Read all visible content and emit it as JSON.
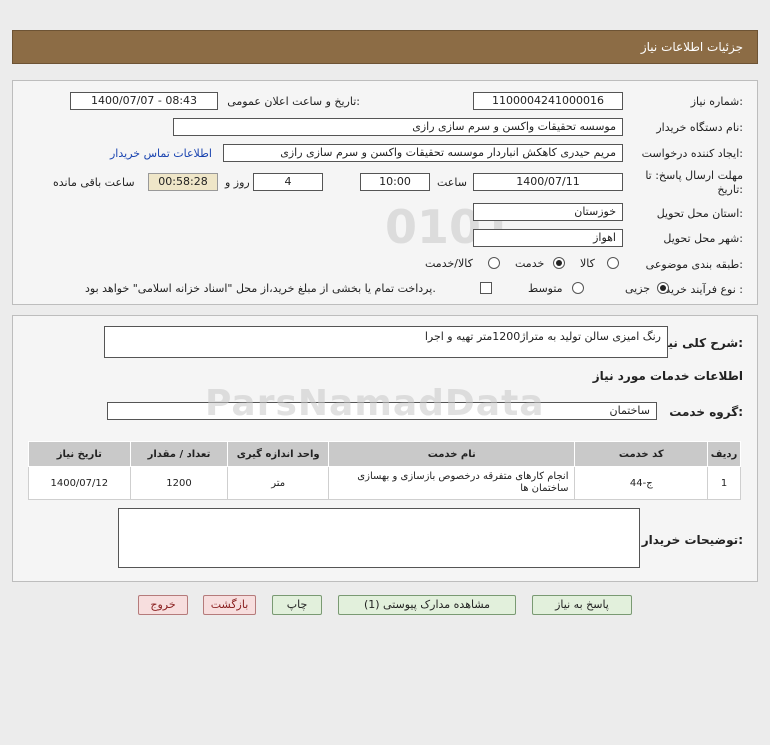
{
  "header": {
    "title": "جزئیات اطلاعات نیاز"
  },
  "form": {
    "need_number_label": "شماره نیاز:",
    "need_number": "1100004241000016",
    "announce_label": "تاریخ و ساعت اعلان عمومی:",
    "announce_value": "1400/07/07 - 08:43",
    "buyer_org_label": "نام دستگاه خریدار:",
    "buyer_org": "موسسه تحقیقات واکسن و سرم سازی رازی",
    "creator_label": "ایجاد کننده درخواست:",
    "creator": "مریم حیدری کاهکش انباردار موسسه تحقیقات واکسن و سرم سازی رازی",
    "contact_link": "اطلاعات تماس خریدار",
    "deadline_label_1": "مهلت ارسال پاسخ: تا",
    "deadline_label_2": "تاریخ:",
    "deadline_date": "1400/07/11",
    "time_label": "ساعت",
    "deadline_time": "10:00",
    "days_value": "4",
    "days_label": "روز و",
    "remaining_time": "00:58:28",
    "remaining_label": "ساعت باقی مانده",
    "province_label": "استان محل تحویل:",
    "province": "خوزستان",
    "city_label": "شهر محل تحویل:",
    "city": "اهواز",
    "category_label": "طبقه بندی موضوعی:",
    "category_options": [
      "کالا",
      "خدمت",
      "کالا/خدمت"
    ],
    "purchase_type_label": "نوع فرآیند خرید :",
    "purchase_options": [
      "جزیی",
      "متوسط"
    ],
    "payment_note": "پرداخت تمام یا بخشی از مبلغ خرید،از محل \"اسناد خزانه اسلامی\" خواهد بود."
  },
  "details": {
    "summary_label": "شرح کلی نیاز:",
    "summary": "رنگ امیزی سالن تولید به متراژ1200متر تهیه و اجرا",
    "services_title": "اطلاعات خدمات مورد نیاز",
    "service_group_label": "گروه خدمت:",
    "service_group": "ساختمان",
    "table": {
      "headers": [
        "ردیف",
        "کد خدمت",
        "نام خدمت",
        "واحد اندازه گیری",
        "تعداد / مقدار",
        "تاریخ نیاز"
      ],
      "rows": [
        [
          "1",
          "ج-44",
          "انجام کارهای متفرقه درخصوص بازسازی و بهسازی ساختمان ها",
          "متر",
          "1200",
          "1400/07/12"
        ]
      ]
    },
    "buyer_notes_label": "توضیحات خریدار:",
    "buyer_notes": ""
  },
  "buttons": {
    "reply": "پاسخ به نیاز",
    "attachments": "مشاهده مدارک پیوستی (1)",
    "print": "چاپ",
    "back": "بازگشت",
    "exit": "خروج"
  }
}
